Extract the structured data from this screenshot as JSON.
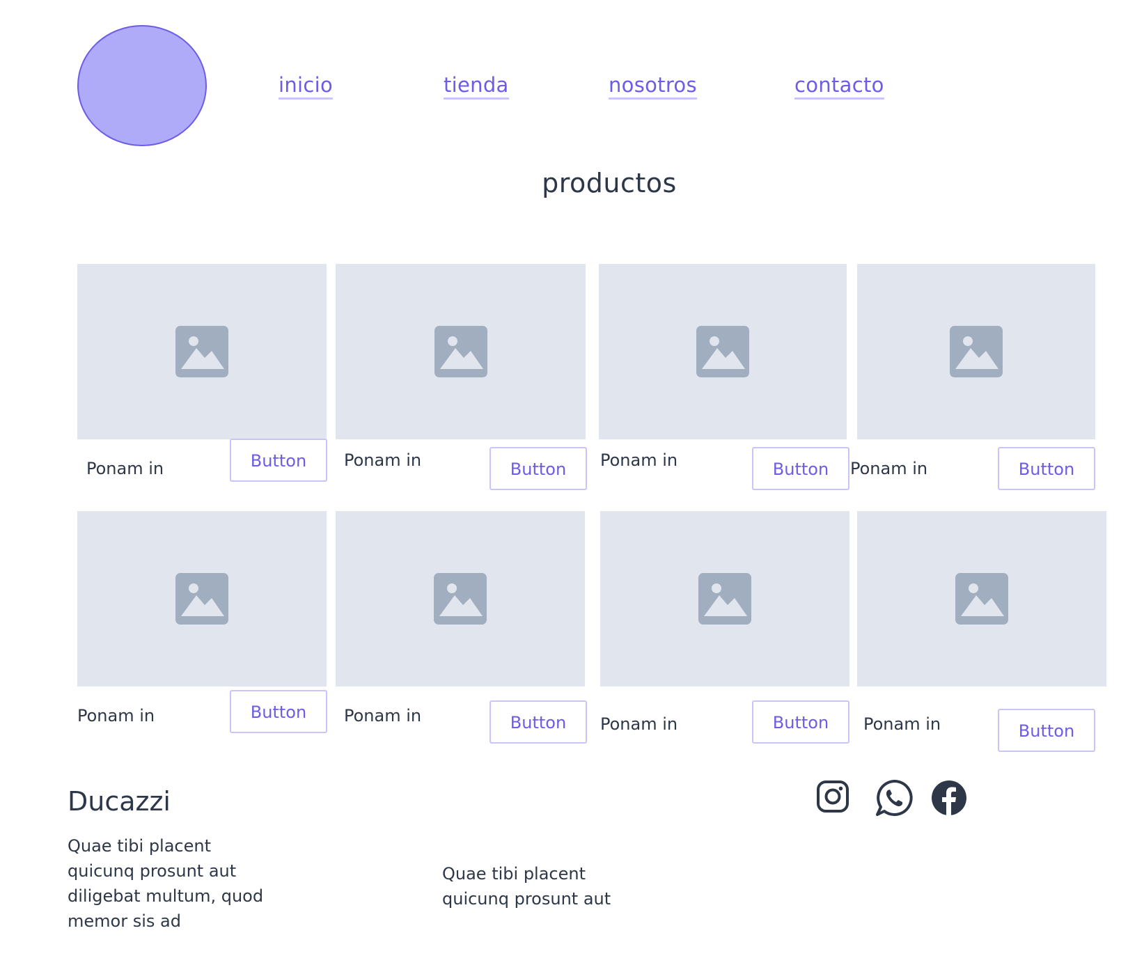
{
  "header": {
    "nav": [
      {
        "label": "inicio"
      },
      {
        "label": "tienda"
      },
      {
        "label": "nosotros"
      },
      {
        "label": "contacto"
      }
    ]
  },
  "main": {
    "title": "productos",
    "products": [
      {
        "name": "Ponam in",
        "button": "Button"
      },
      {
        "name": "Ponam in",
        "button": "Button"
      },
      {
        "name": "Ponam in",
        "button": "Button"
      },
      {
        "name": "Ponam in",
        "button": "Button"
      },
      {
        "name": "Ponam in",
        "button": "Button"
      },
      {
        "name": "Ponam in",
        "button": "Button"
      },
      {
        "name": "Ponam in",
        "button": "Button"
      },
      {
        "name": "Ponam in",
        "button": "Button"
      }
    ]
  },
  "footer": {
    "brand": "Ducazzi",
    "text_left": "Quae tibi placent quicunq prosunt aut diligebat multum, quod memor sis ad",
    "text_right": "Quae tibi placent quicunq prosunt aut",
    "social_icons": [
      "instagram-icon",
      "whatsapp-icon",
      "facebook-icon"
    ]
  },
  "colors": {
    "accent": "#6c5ce7",
    "logo_fill": "#b0abf8",
    "placeholder_bg": "#e1e6ee",
    "placeholder_icon": "#a0aec0",
    "text": "#2d3748"
  }
}
